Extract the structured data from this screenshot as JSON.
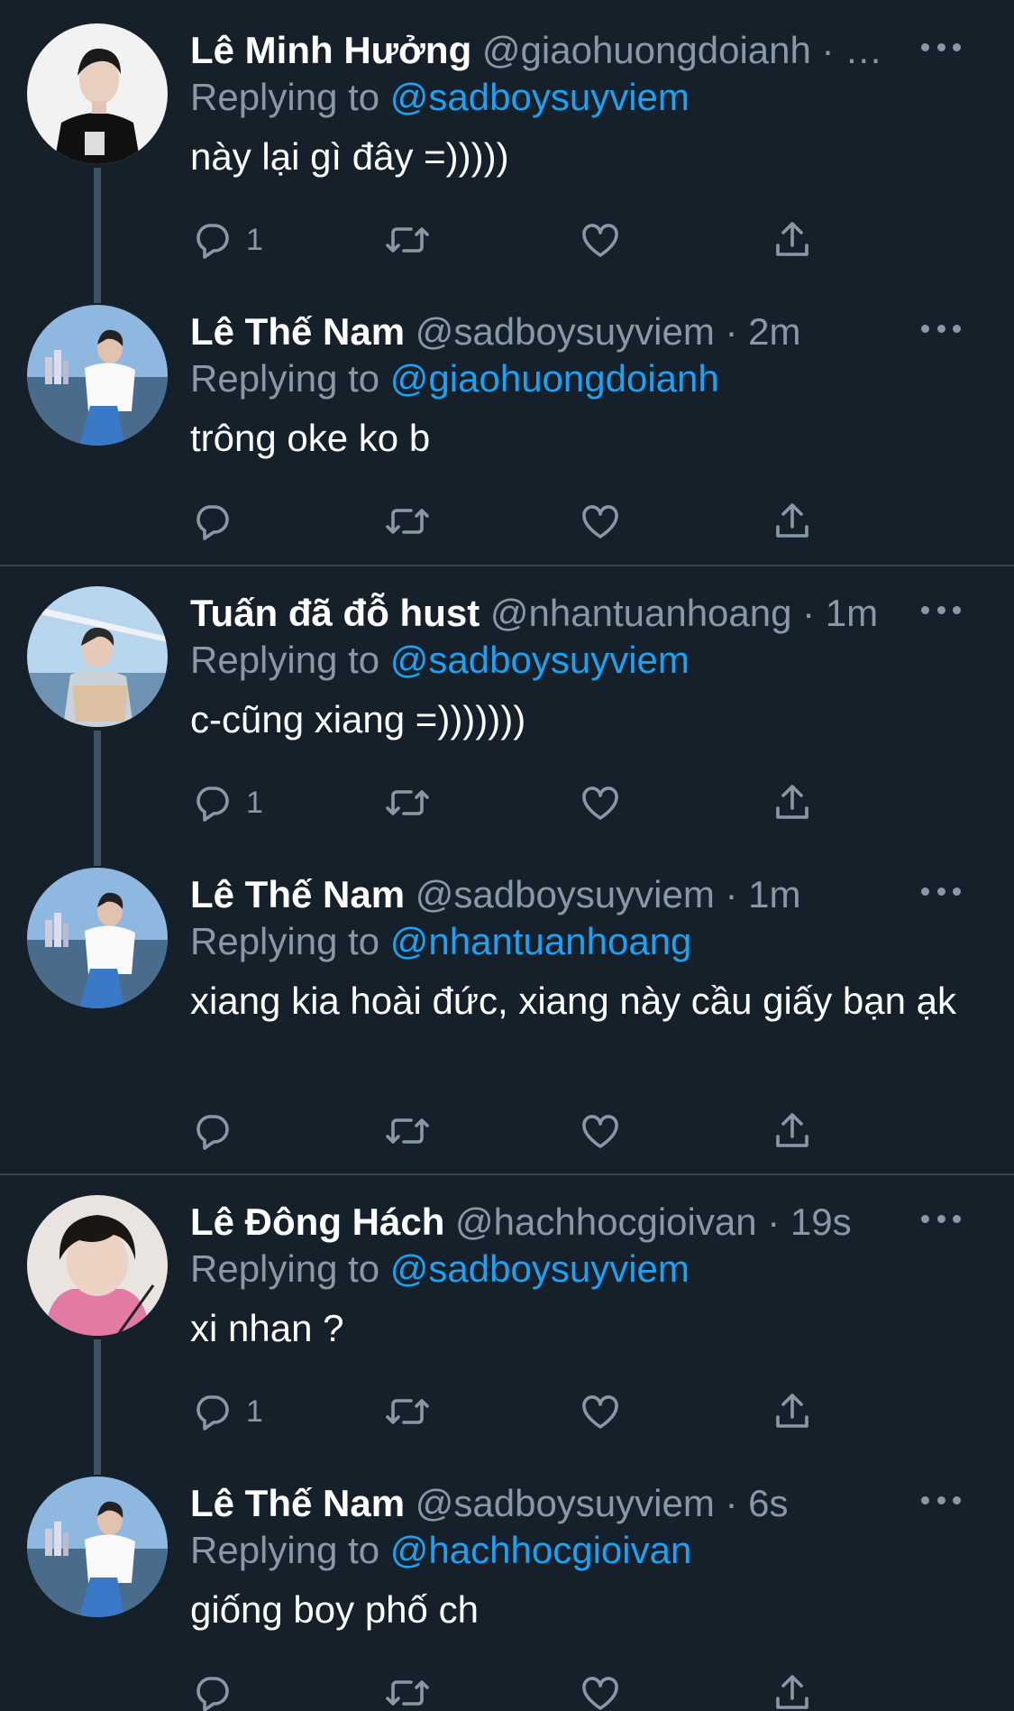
{
  "colors": {
    "background": "#15202b",
    "divider": "#38444d",
    "handle_gray": "#8899a6",
    "mention_blue": "#1da1f2",
    "thread_line": "#3d5466"
  },
  "threads": [
    {
      "tweets": [
        {
          "name": "Lê Minh Hưởng",
          "handle": "@giaohuongdoianh",
          "meta": " · …",
          "replying_prefix": "Replying to",
          "replying_to": "@sadboysuyviem",
          "text": "này lại gì đây =)))))",
          "reply_count": "1",
          "icons": [
            "reply-icon",
            "retweet-icon",
            "like-icon",
            "share-icon",
            "more-icon"
          ]
        },
        {
          "name": "Lê Thế Nam",
          "handle": "@sadboysuyviem",
          "meta": " · 2m",
          "replying_prefix": "Replying to",
          "replying_to": "@giaohuongdoianh",
          "text": "trông oke ko b",
          "reply_count": ""
        }
      ]
    },
    {
      "tweets": [
        {
          "name": "Tuấn đã đỗ hust",
          "handle": "@nhantuanhoang",
          "meta": " · 1m",
          "replying_prefix": "Replying to",
          "replying_to": "@sadboysuyviem",
          "text": "c-cũng xiang =)))))))",
          "reply_count": "1"
        },
        {
          "name": "Lê Thế Nam",
          "handle": "@sadboysuyviem",
          "meta": " · 1m",
          "replying_prefix": "Replying to",
          "replying_to": "@nhantuanhoang",
          "text": "xiang kia hoài đức, xiang này cầu giấy bạn ạk",
          "reply_count": ""
        }
      ]
    },
    {
      "tweets": [
        {
          "name": "Lê Đông Hách",
          "handle": "@hachhocgioivan",
          "meta": " · 19s",
          "replying_prefix": "Replying to",
          "replying_to": "@sadboysuyviem",
          "text": "xi nhan ?",
          "reply_count": "1"
        },
        {
          "name": "Lê Thế Nam",
          "handle": "@sadboysuyviem",
          "meta": " · 6s",
          "replying_prefix": "Replying to",
          "replying_to": "@hachhocgioivan",
          "text": "giống boy phố ch",
          "reply_count": ""
        }
      ]
    }
  ]
}
